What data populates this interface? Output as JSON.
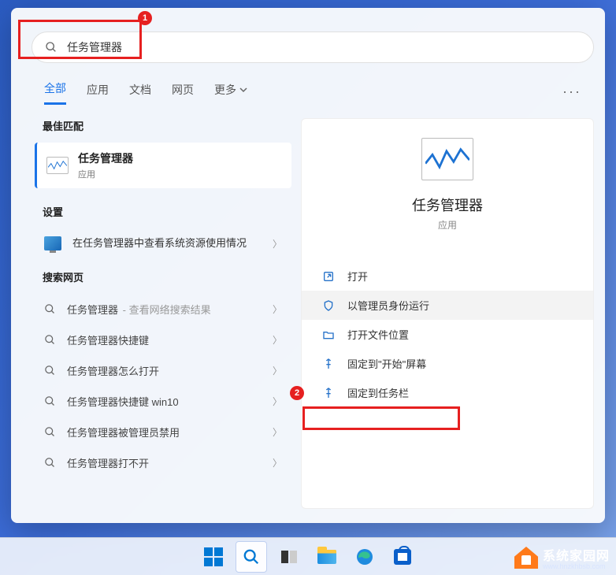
{
  "search": {
    "value": "任务管理器"
  },
  "tabs": {
    "all": "全部",
    "apps": "应用",
    "docs": "文档",
    "web": "网页",
    "more": "更多"
  },
  "sections": {
    "bestMatch": "最佳匹配",
    "settings": "设置",
    "searchWeb": "搜索网页"
  },
  "bestMatch": {
    "title": "任务管理器",
    "subtitle": "应用"
  },
  "settingsItem": "在任务管理器中查看系统资源使用情况",
  "webItems": [
    {
      "text": "任务管理器",
      "hint": " - 查看网络搜索结果"
    },
    {
      "text": "任务管理器快捷键",
      "hint": ""
    },
    {
      "text": "任务管理器怎么打开",
      "hint": ""
    },
    {
      "text": "任务管理器快捷键 win10",
      "hint": ""
    },
    {
      "text": "任务管理器被管理员禁用",
      "hint": ""
    },
    {
      "text": "任务管理器打不开",
      "hint": ""
    }
  ],
  "preview": {
    "title": "任务管理器",
    "subtitle": "应用"
  },
  "actions": {
    "open": "打开",
    "runAsAdmin": "以管理员身份运行",
    "openLocation": "打开文件位置",
    "pinStart": "固定到\"开始\"屏幕",
    "pinTaskbar": "固定到任务栏"
  },
  "annotations": {
    "b1": "1",
    "b2": "2"
  },
  "watermark": {
    "line1": "系统家园网",
    "line2": "www.hnzkhbsb.com"
  }
}
